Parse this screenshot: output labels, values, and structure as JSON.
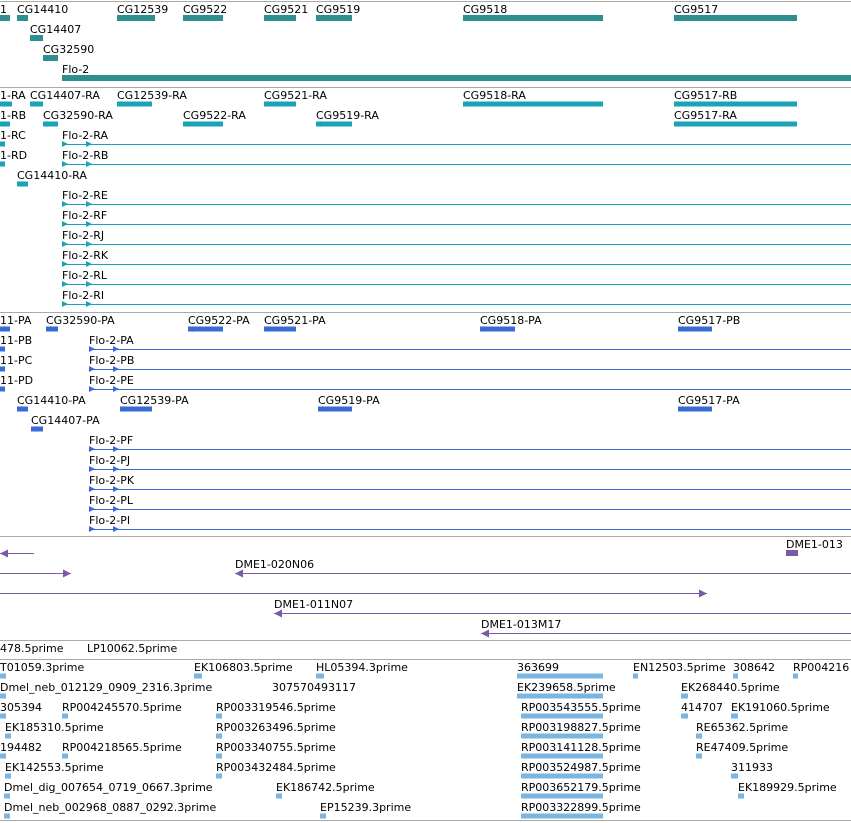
{
  "colors": {
    "gene": "#2f8f90",
    "mrna": "#1aa3b8",
    "protein": "#3a6bd4",
    "clone": "#7b5aa6",
    "est": "#7ab6e0",
    "divider": "#a9a9a9"
  },
  "tracks": [
    {
      "name": "genes",
      "color_key": "gene",
      "features": [
        {
          "label": "1",
          "start": 0,
          "end": 10,
          "row": 0,
          "style": "bar"
        },
        {
          "label": "CG14410",
          "start": 17,
          "end": 28,
          "row": 0,
          "style": "bar"
        },
        {
          "label": "CG12539",
          "start": 117,
          "end": 155,
          "row": 0,
          "style": "bar"
        },
        {
          "label": "CG9522",
          "start": 183,
          "end": 223,
          "row": 0,
          "style": "bar"
        },
        {
          "label": "CG9521",
          "start": 264,
          "end": 296,
          "row": 0,
          "style": "bar"
        },
        {
          "label": "CG9519",
          "start": 316,
          "end": 352,
          "row": 0,
          "style": "bar"
        },
        {
          "label": "CG9518",
          "start": 463,
          "end": 603,
          "row": 0,
          "style": "bar"
        },
        {
          "label": "CG9517",
          "start": 674,
          "end": 797,
          "row": 0,
          "style": "bar"
        },
        {
          "label": "CG14407",
          "start": 30,
          "end": 43,
          "row": 1,
          "style": "bar"
        },
        {
          "label": "CG32590",
          "start": 43,
          "end": 58,
          "row": 2,
          "style": "bar"
        },
        {
          "label": "Flo-2",
          "start": 62,
          "end": 851,
          "row": 3,
          "style": "bar"
        }
      ]
    },
    {
      "name": "mrna",
      "color_key": "mrna",
      "features": [
        {
          "label": "1-RA",
          "start": 0,
          "end": 12,
          "row": 0,
          "style": "gene"
        },
        {
          "label": "CG14407-RA",
          "start": 30,
          "end": 43,
          "row": 0,
          "style": "gene"
        },
        {
          "label": "CG12539-RA",
          "start": 117,
          "end": 152,
          "row": 0,
          "style": "gene"
        },
        {
          "label": "CG9521-RA",
          "start": 264,
          "end": 296,
          "row": 0,
          "style": "gene"
        },
        {
          "label": "CG9518-RA",
          "start": 463,
          "end": 603,
          "row": 0,
          "style": "gene"
        },
        {
          "label": "CG9517-RB",
          "start": 674,
          "end": 797,
          "row": 0,
          "style": "gene"
        },
        {
          "label": "1-RB",
          "start": 0,
          "end": 10,
          "row": 1,
          "style": "gene"
        },
        {
          "label": "CG32590-RA",
          "start": 43,
          "end": 58,
          "row": 1,
          "style": "gene"
        },
        {
          "label": "CG9522-RA",
          "start": 183,
          "end": 223,
          "row": 1,
          "style": "gene"
        },
        {
          "label": "CG9519-RA",
          "start": 316,
          "end": 352,
          "row": 1,
          "style": "gene"
        },
        {
          "label": "CG9517-RA",
          "start": 674,
          "end": 797,
          "row": 1,
          "style": "gene"
        },
        {
          "label": "1-RC",
          "start": 0,
          "end": 4,
          "row": 2,
          "style": "gene"
        },
        {
          "label": "Flo-2-RA",
          "start": 62,
          "end": 851,
          "row": 2,
          "style": "line"
        },
        {
          "label": "1-RD",
          "start": 0,
          "end": 4,
          "row": 3,
          "style": "gene"
        },
        {
          "label": "Flo-2-RB",
          "start": 62,
          "end": 851,
          "row": 3,
          "style": "line"
        },
        {
          "label": "CG14410-RA",
          "start": 17,
          "end": 28,
          "row": 4,
          "style": "gene"
        },
        {
          "label": "Flo-2-RE",
          "start": 62,
          "end": 851,
          "row": 5,
          "style": "line"
        },
        {
          "label": "Flo-2-RF",
          "start": 62,
          "end": 851,
          "row": 6,
          "style": "line"
        },
        {
          "label": "Flo-2-RJ",
          "start": 62,
          "end": 851,
          "row": 7,
          "style": "line"
        },
        {
          "label": "Flo-2-RK",
          "start": 62,
          "end": 851,
          "row": 8,
          "style": "line"
        },
        {
          "label": "Flo-2-RL",
          "start": 62,
          "end": 851,
          "row": 9,
          "style": "line"
        },
        {
          "label": "Flo-2-RI",
          "start": 62,
          "end": 851,
          "row": 10,
          "style": "line"
        }
      ]
    },
    {
      "name": "proteins",
      "color_key": "protein",
      "features": [
        {
          "label": "11-PA",
          "start": 0,
          "end": 10,
          "row": 0,
          "style": "gene"
        },
        {
          "label": "CG32590-PA",
          "start": 46,
          "end": 58,
          "row": 0,
          "style": "gene"
        },
        {
          "label": "CG9522-PA",
          "start": 188,
          "end": 223,
          "row": 0,
          "style": "gene"
        },
        {
          "label": "CG9521-PA",
          "start": 264,
          "end": 296,
          "row": 0,
          "style": "gene"
        },
        {
          "label": "CG9518-PA",
          "start": 480,
          "end": 515,
          "row": 0,
          "style": "gene"
        },
        {
          "label": "CG9517-PB",
          "start": 678,
          "end": 712,
          "row": 0,
          "style": "gene"
        },
        {
          "label": "11-PB",
          "start": 0,
          "end": 4,
          "row": 1,
          "style": "gene"
        },
        {
          "label": "Flo-2-PA",
          "start": 89,
          "end": 851,
          "row": 1,
          "style": "line"
        },
        {
          "label": "11-PC",
          "start": 0,
          "end": 4,
          "row": 2,
          "style": "gene"
        },
        {
          "label": "Flo-2-PB",
          "start": 89,
          "end": 851,
          "row": 2,
          "style": "line"
        },
        {
          "label": "11-PD",
          "start": 0,
          "end": 4,
          "row": 3,
          "style": "gene"
        },
        {
          "label": "Flo-2-PE",
          "start": 89,
          "end": 851,
          "row": 3,
          "style": "line"
        },
        {
          "label": "CG14410-PA",
          "start": 17,
          "end": 28,
          "row": 4,
          "style": "gene"
        },
        {
          "label": "CG12539-PA",
          "start": 120,
          "end": 152,
          "row": 4,
          "style": "gene"
        },
        {
          "label": "CG9519-PA",
          "start": 318,
          "end": 352,
          "row": 4,
          "style": "gene"
        },
        {
          "label": "CG9517-PA",
          "start": 678,
          "end": 712,
          "row": 4,
          "style": "gene"
        },
        {
          "label": "CG14407-PA",
          "start": 31,
          "end": 43,
          "row": 5,
          "style": "gene"
        },
        {
          "label": "Flo-2-PF",
          "start": 89,
          "end": 851,
          "row": 6,
          "style": "line"
        },
        {
          "label": "Flo-2-PJ",
          "start": 89,
          "end": 851,
          "row": 7,
          "style": "line"
        },
        {
          "label": "Flo-2-PK",
          "start": 89,
          "end": 851,
          "row": 8,
          "style": "line"
        },
        {
          "label": "Flo-2-PL",
          "start": 89,
          "end": 851,
          "row": 9,
          "style": "line"
        },
        {
          "label": "Flo-2-PI",
          "start": 89,
          "end": 851,
          "row": 10,
          "style": "line"
        }
      ]
    },
    {
      "name": "clones",
      "color_key": "clone",
      "features": [
        {
          "label": "",
          "start": 0,
          "end": 34,
          "row": 0,
          "style": "line",
          "dir": "left"
        },
        {
          "label": "DME1-013",
          "start": 786,
          "end": 798,
          "row": 0,
          "style": "bar"
        },
        {
          "label": "",
          "start": 0,
          "end": 71,
          "row": 1,
          "style": "line",
          "dir": "right"
        },
        {
          "label": "DME1-020N06",
          "start": 235,
          "end": 851,
          "row": 1,
          "style": "line",
          "dir": "left"
        },
        {
          "label": "",
          "start": 0,
          "end": 707,
          "row": 2,
          "style": "line",
          "dir": "right"
        },
        {
          "label": "DME1-011N07",
          "start": 274,
          "end": 851,
          "row": 3,
          "style": "line",
          "dir": "left"
        },
        {
          "label": "DME1-013M17",
          "start": 481,
          "end": 851,
          "row": 4,
          "style": "line",
          "dir": "left"
        }
      ]
    },
    {
      "name": "ests",
      "color_key": "est",
      "features": [
        {
          "label": "478.5prime",
          "start": 0,
          "end": 0,
          "row": 0,
          "style": "none"
        },
        {
          "label": "LP10062.5prime",
          "start": 87,
          "end": 87,
          "row": 0,
          "style": "none"
        }
      ]
    },
    {
      "name": "ests2",
      "color_key": "est",
      "features": [
        {
          "label": "T01059.3prime",
          "start": 0,
          "end": 6,
          "row": 0,
          "style": "gene"
        },
        {
          "label": "EK106803.5prime",
          "start": 194,
          "end": 202,
          "row": 0,
          "style": "gene"
        },
        {
          "label": "HL05394.3prime",
          "start": 316,
          "end": 324,
          "row": 0,
          "style": "gene"
        },
        {
          "label": "363699",
          "start": 517,
          "end": 603,
          "row": 0,
          "style": "gene"
        },
        {
          "label": "EN12503.5prime",
          "start": 633,
          "end": 638,
          "row": 0,
          "style": "gene"
        },
        {
          "label": "308642",
          "start": 733,
          "end": 738,
          "row": 0,
          "style": "gene"
        },
        {
          "label": "RP004216",
          "start": 793,
          "end": 798,
          "row": 0,
          "style": "gene"
        },
        {
          "label": "Dmel_neb_012129_0909_2316.3prime",
          "start": 0,
          "end": 6,
          "row": 1,
          "style": "gene"
        },
        {
          "label": "307570493117",
          "start": 272,
          "end": 272,
          "row": 1,
          "style": "none"
        },
        {
          "label": "EK239658.5prime",
          "start": 517,
          "end": 603,
          "row": 1,
          "style": "gene"
        },
        {
          "label": "EK268440.5prime",
          "start": 681,
          "end": 688,
          "row": 1,
          "style": "gene"
        },
        {
          "label": "305394",
          "start": 0,
          "end": 6,
          "row": 2,
          "style": "gene"
        },
        {
          "label": "RP004245570.5prime",
          "start": 62,
          "end": 68,
          "row": 2,
          "style": "gene"
        },
        {
          "label": "RP003319546.5prime",
          "start": 216,
          "end": 222,
          "row": 2,
          "style": "gene"
        },
        {
          "label": "RP003543555.5prime",
          "start": 521,
          "end": 603,
          "row": 2,
          "style": "gene"
        },
        {
          "label": "414707",
          "start": 681,
          "end": 688,
          "row": 2,
          "style": "gene"
        },
        {
          "label": "EK191060.5prime",
          "start": 731,
          "end": 738,
          "row": 2,
          "style": "gene"
        },
        {
          "label": "EK185310.5prime",
          "start": 5,
          "end": 11,
          "row": 3,
          "style": "gene"
        },
        {
          "label": "RP003263496.5prime",
          "start": 216,
          "end": 222,
          "row": 3,
          "style": "gene"
        },
        {
          "label": "RP003198827.5prime",
          "start": 521,
          "end": 603,
          "row": 3,
          "style": "gene"
        },
        {
          "label": "RE65362.5prime",
          "start": 696,
          "end": 702,
          "row": 3,
          "style": "gene"
        },
        {
          "label": "194482",
          "start": 0,
          "end": 6,
          "row": 4,
          "style": "gene"
        },
        {
          "label": "RP004218565.5prime",
          "start": 62,
          "end": 68,
          "row": 4,
          "style": "gene"
        },
        {
          "label": "RP003340755.5prime",
          "start": 216,
          "end": 222,
          "row": 4,
          "style": "gene"
        },
        {
          "label": "RP003141128.5prime",
          "start": 521,
          "end": 603,
          "row": 4,
          "style": "gene"
        },
        {
          "label": "RE47409.5prime",
          "start": 696,
          "end": 702,
          "row": 4,
          "style": "gene"
        },
        {
          "label": "EK142553.5prime",
          "start": 5,
          "end": 11,
          "row": 5,
          "style": "gene"
        },
        {
          "label": "RP003432484.5prime",
          "start": 216,
          "end": 222,
          "row": 5,
          "style": "gene"
        },
        {
          "label": "RP003524987.5prime",
          "start": 521,
          "end": 603,
          "row": 5,
          "style": "gene"
        },
        {
          "label": "311933",
          "start": 731,
          "end": 738,
          "row": 5,
          "style": "gene"
        },
        {
          "label": "Dmel_dig_007654_0719_0667.3prime",
          "start": 4,
          "end": 10,
          "row": 6,
          "style": "gene"
        },
        {
          "label": "EK186742.5prime",
          "start": 276,
          "end": 282,
          "row": 6,
          "style": "gene"
        },
        {
          "label": "RP003652179.5prime",
          "start": 521,
          "end": 603,
          "row": 6,
          "style": "gene"
        },
        {
          "label": "EK189929.5prime",
          "start": 738,
          "end": 744,
          "row": 6,
          "style": "gene"
        },
        {
          "label": "Dmel_neb_002968_0887_0292.3prime",
          "start": 4,
          "end": 10,
          "row": 7,
          "style": "gene"
        },
        {
          "label": "EP15239.3prime",
          "start": 320,
          "end": 326,
          "row": 7,
          "style": "gene"
        },
        {
          "label": "RP003322899.5prime",
          "start": 521,
          "end": 603,
          "row": 7,
          "style": "gene"
        }
      ]
    }
  ]
}
